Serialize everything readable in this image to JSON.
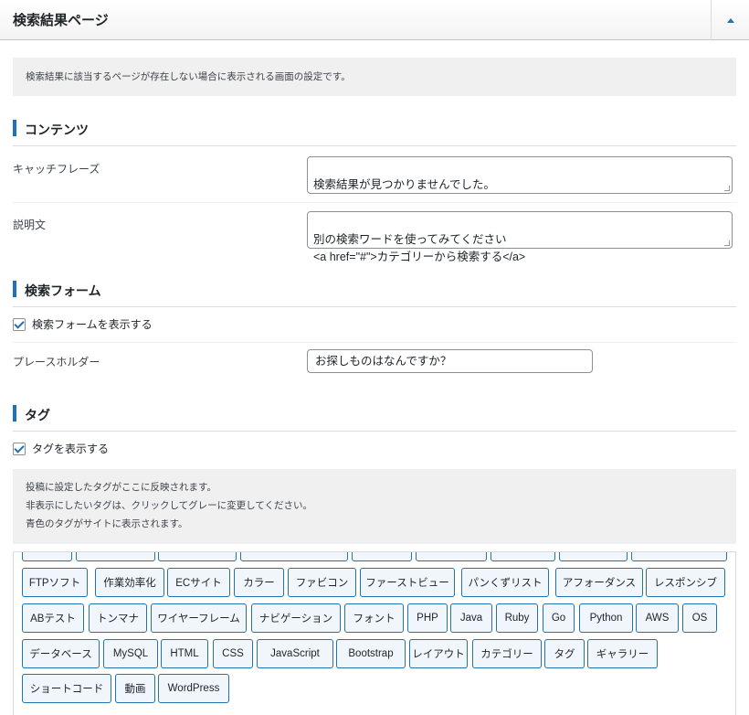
{
  "header": {
    "title": "検索結果ページ",
    "toggle_icon": "arrow-up-icon"
  },
  "notice_top": "検索結果に該当するページが存在しない場合に表示される画面の設定です。",
  "sections": {
    "contents": "コンテンツ",
    "search_form": "検索フォーム",
    "tags": "タグ"
  },
  "fields": {
    "catchphrase": {
      "label": "キャッチフレーズ",
      "value": "検索結果が見つかりませんでした。"
    },
    "description": {
      "label": "説明文",
      "value": "別の検索ワードを使ってみてください\n<a href=\"#\">カテゴリーから検索する</a>"
    },
    "show_search_form": {
      "label": "検索フォームを表示する",
      "checked": true
    },
    "placeholder": {
      "label": "プレースホルダー",
      "value": "お探しものはなんですか？"
    },
    "show_tags": {
      "label": "タグを表示する",
      "checked": true
    }
  },
  "tags_notice": [
    "投稿に設定したタグがここに反映されます。",
    "非表示にしたいタグは、クリックしてグレーに変更してください。",
    "青色のタグがサイトに表示されます。"
  ],
  "tags": [
    "FTPソフト",
    "作業効率化",
    "ECサイト",
    "カラー",
    "ファビコン",
    "ファーストビュー",
    "パンくずリスト",
    "アフォーダンス",
    "レスポンシブ",
    "ABテスト",
    "トンマナ",
    "ワイヤーフレーム",
    "ナビゲーション",
    "フォント",
    "PHP",
    "Java",
    "Ruby",
    "Go",
    "Python",
    "AWS",
    "OS",
    "データベース",
    "MySQL",
    "HTML",
    "CSS",
    "JavaScript",
    "Bootstrap",
    "レイアウト",
    "カテゴリー",
    "タグ",
    "ギャラリー",
    "ショートコード",
    "動画",
    "WordPress"
  ],
  "colors": {
    "accent": "#2271b1",
    "tag_bg": "#f0f6fc",
    "notice_bg": "#f0f0f1"
  }
}
